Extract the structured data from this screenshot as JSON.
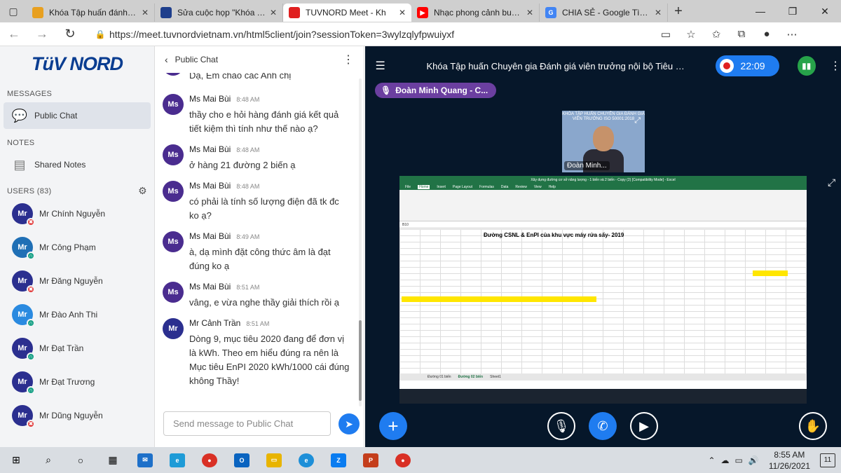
{
  "browser": {
    "tabs": [
      {
        "title": "Khóa Tập huấn đánh giá v",
        "fav_color": "#e8a020",
        "fav_text": ""
      },
      {
        "title": "Sửa cuộc họp \"Khóa Tập h",
        "fav_color": "#1e3e8c",
        "fav_text": ""
      },
      {
        "title": "TUVNORD Meet - Kh",
        "fav_color": "#e02020",
        "fav_text": "",
        "active": true
      },
      {
        "title": "Nhạc phong cảnh buổi sá",
        "fav_color": "#ff0000",
        "fav_text": "▶"
      },
      {
        "title": "CHIA SẺ - Google Tìm kiế",
        "fav_color": "#4285f4",
        "fav_text": "G"
      }
    ],
    "url": "https://meet.tuvnordvietnam.vn/html5client/join?sessionToken=3wylzqlyfpwuiyxf"
  },
  "sidebar": {
    "logo": "TüV NORD",
    "messages_header": "MESSAGES",
    "public_chat": "Public Chat",
    "notes_header": "NOTES",
    "shared_notes": "Shared Notes",
    "users_header": "USERS (83)",
    "users": [
      {
        "initials": "Mr",
        "name": "Mr Chính Nguyễn",
        "color": "#2b2f8f",
        "badge": "#e23b3b",
        "badge_icon": "✖"
      },
      {
        "initials": "Mr",
        "name": "Mr Công Phạm",
        "color": "#1f6fb5",
        "badge": "#16a085",
        "badge_icon": "∩"
      },
      {
        "initials": "Mr",
        "name": "Mr Đăng Nguyễn",
        "color": "#2b2f8f",
        "badge": "#e23b3b",
        "badge_icon": "✖"
      },
      {
        "initials": "Mr",
        "name": "Mr Đào Anh Thi",
        "color": "#2a8ae0",
        "badge": "#16a085",
        "badge_icon": "∩"
      },
      {
        "initials": "Mr",
        "name": "Mr Đạt Trần",
        "color": "#2b2f8f",
        "badge": "#16a085",
        "badge_icon": "∩"
      },
      {
        "initials": "Mr",
        "name": "Mr Đạt Trương",
        "color": "#2b2f8f",
        "badge": "#16a085",
        "badge_icon": "∩"
      },
      {
        "initials": "Mr",
        "name": "Mr Dũng Nguyễn",
        "color": "#2b2f8f",
        "badge": "#e23b3b",
        "badge_icon": "✖"
      }
    ]
  },
  "chat": {
    "title": "Public Chat",
    "first_partial": "Dạ, Em chào các Anh chị",
    "messages": [
      {
        "initials": "Ms",
        "name": "Ms Mai Bùi",
        "time": "8:48 AM",
        "text": "thầy cho e hỏi hàng đánh giá kết quả tiết kiệm thì tính như thế nào ạ?",
        "color": "#4a2c8f"
      },
      {
        "initials": "Ms",
        "name": "Ms Mai Bùi",
        "time": "8:48 AM",
        "text": "ở hàng 21 đường 2 biến ạ",
        "color": "#4a2c8f"
      },
      {
        "initials": "Ms",
        "name": "Ms Mai Bùi",
        "time": "8:48 AM",
        "text": "có phải là tính số lượng điện đã tk đc ko ạ?",
        "color": "#4a2c8f"
      },
      {
        "initials": "Ms",
        "name": "Ms Mai Bùi",
        "time": "8:49 AM",
        "text": "à, dạ mình đặt công thức âm là đạt đúng ko ạ",
        "color": "#4a2c8f"
      },
      {
        "initials": "Ms",
        "name": "Ms Mai Bùi",
        "time": "8:51 AM",
        "text": "vâng, e vừa nghe thầy giải thích rồi ạ",
        "color": "#4a2c8f"
      },
      {
        "initials": "Mr",
        "name": "Mr Cảnh Trần",
        "time": "8:51 AM",
        "text": "Dòng 9, mục tiêu 2020 đang để đơn vị là kWh. Theo em hiểu đúng ra nên là Mục tiêu EnPI 2020 kWh/1000 cái đúng không Thầy!",
        "color": "#2b2f8f"
      }
    ],
    "placeholder": "Send message to Public Chat"
  },
  "meeting": {
    "title": "Khóa Tập huấn Chuyên gia Đánh giá viên trưởng nội bộ Tiêu chuẩ...",
    "timer": "22:09",
    "talking": "Đoàn Minh Quang - C...",
    "webcam_name": "Đoàn Minh...",
    "webcam_banner": "KHÓA TẬP HUẤN CHUYÊN GIA ĐÁNH GIÁ VIÊN TRƯỞNG ISO 50001:2018",
    "sheet_title": "Đường CSNL & EnPI của khu vực máy rửa sấy- 2019",
    "excel_window": "Xây dựng đường cơ sở năng lượng - 1 biến và 2 biến - Copy (2) [Compatibility Mode] - Excel",
    "excel_menu": [
      "File",
      "Home",
      "Insert",
      "Page Layout",
      "Formulas",
      "Data",
      "Review",
      "View",
      "Help"
    ],
    "excel_tabs": [
      "Đường 01 biến",
      "Đường 02 biến",
      "Sheet1"
    ],
    "cell_ref": "B10"
  },
  "taskbar": {
    "time": "8:55 AM",
    "date": "11/26/2021",
    "notifications": "11"
  }
}
